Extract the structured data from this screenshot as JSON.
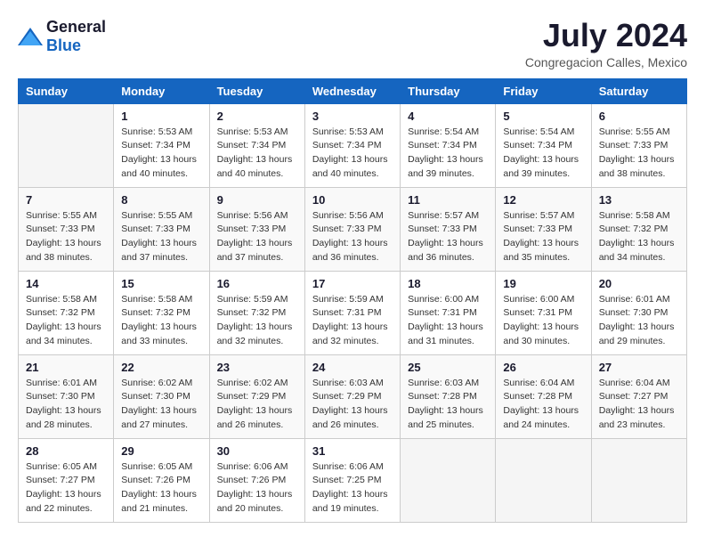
{
  "header": {
    "logo_general": "General",
    "logo_blue": "Blue",
    "month_title": "July 2024",
    "location": "Congregacion Calles, Mexico"
  },
  "weekdays": [
    "Sunday",
    "Monday",
    "Tuesday",
    "Wednesday",
    "Thursday",
    "Friday",
    "Saturday"
  ],
  "weeks": [
    [
      {
        "day": "",
        "info": ""
      },
      {
        "day": "1",
        "info": "Sunrise: 5:53 AM\nSunset: 7:34 PM\nDaylight: 13 hours\nand 40 minutes."
      },
      {
        "day": "2",
        "info": "Sunrise: 5:53 AM\nSunset: 7:34 PM\nDaylight: 13 hours\nand 40 minutes."
      },
      {
        "day": "3",
        "info": "Sunrise: 5:53 AM\nSunset: 7:34 PM\nDaylight: 13 hours\nand 40 minutes."
      },
      {
        "day": "4",
        "info": "Sunrise: 5:54 AM\nSunset: 7:34 PM\nDaylight: 13 hours\nand 39 minutes."
      },
      {
        "day": "5",
        "info": "Sunrise: 5:54 AM\nSunset: 7:34 PM\nDaylight: 13 hours\nand 39 minutes."
      },
      {
        "day": "6",
        "info": "Sunrise: 5:55 AM\nSunset: 7:33 PM\nDaylight: 13 hours\nand 38 minutes."
      }
    ],
    [
      {
        "day": "7",
        "info": "Sunrise: 5:55 AM\nSunset: 7:33 PM\nDaylight: 13 hours\nand 38 minutes."
      },
      {
        "day": "8",
        "info": "Sunrise: 5:55 AM\nSunset: 7:33 PM\nDaylight: 13 hours\nand 37 minutes."
      },
      {
        "day": "9",
        "info": "Sunrise: 5:56 AM\nSunset: 7:33 PM\nDaylight: 13 hours\nand 37 minutes."
      },
      {
        "day": "10",
        "info": "Sunrise: 5:56 AM\nSunset: 7:33 PM\nDaylight: 13 hours\nand 36 minutes."
      },
      {
        "day": "11",
        "info": "Sunrise: 5:57 AM\nSunset: 7:33 PM\nDaylight: 13 hours\nand 36 minutes."
      },
      {
        "day": "12",
        "info": "Sunrise: 5:57 AM\nSunset: 7:33 PM\nDaylight: 13 hours\nand 35 minutes."
      },
      {
        "day": "13",
        "info": "Sunrise: 5:58 AM\nSunset: 7:32 PM\nDaylight: 13 hours\nand 34 minutes."
      }
    ],
    [
      {
        "day": "14",
        "info": "Sunrise: 5:58 AM\nSunset: 7:32 PM\nDaylight: 13 hours\nand 34 minutes."
      },
      {
        "day": "15",
        "info": "Sunrise: 5:58 AM\nSunset: 7:32 PM\nDaylight: 13 hours\nand 33 minutes."
      },
      {
        "day": "16",
        "info": "Sunrise: 5:59 AM\nSunset: 7:32 PM\nDaylight: 13 hours\nand 32 minutes."
      },
      {
        "day": "17",
        "info": "Sunrise: 5:59 AM\nSunset: 7:31 PM\nDaylight: 13 hours\nand 32 minutes."
      },
      {
        "day": "18",
        "info": "Sunrise: 6:00 AM\nSunset: 7:31 PM\nDaylight: 13 hours\nand 31 minutes."
      },
      {
        "day": "19",
        "info": "Sunrise: 6:00 AM\nSunset: 7:31 PM\nDaylight: 13 hours\nand 30 minutes."
      },
      {
        "day": "20",
        "info": "Sunrise: 6:01 AM\nSunset: 7:30 PM\nDaylight: 13 hours\nand 29 minutes."
      }
    ],
    [
      {
        "day": "21",
        "info": "Sunrise: 6:01 AM\nSunset: 7:30 PM\nDaylight: 13 hours\nand 28 minutes."
      },
      {
        "day": "22",
        "info": "Sunrise: 6:02 AM\nSunset: 7:30 PM\nDaylight: 13 hours\nand 27 minutes."
      },
      {
        "day": "23",
        "info": "Sunrise: 6:02 AM\nSunset: 7:29 PM\nDaylight: 13 hours\nand 26 minutes."
      },
      {
        "day": "24",
        "info": "Sunrise: 6:03 AM\nSunset: 7:29 PM\nDaylight: 13 hours\nand 26 minutes."
      },
      {
        "day": "25",
        "info": "Sunrise: 6:03 AM\nSunset: 7:28 PM\nDaylight: 13 hours\nand 25 minutes."
      },
      {
        "day": "26",
        "info": "Sunrise: 6:04 AM\nSunset: 7:28 PM\nDaylight: 13 hours\nand 24 minutes."
      },
      {
        "day": "27",
        "info": "Sunrise: 6:04 AM\nSunset: 7:27 PM\nDaylight: 13 hours\nand 23 minutes."
      }
    ],
    [
      {
        "day": "28",
        "info": "Sunrise: 6:05 AM\nSunset: 7:27 PM\nDaylight: 13 hours\nand 22 minutes."
      },
      {
        "day": "29",
        "info": "Sunrise: 6:05 AM\nSunset: 7:26 PM\nDaylight: 13 hours\nand 21 minutes."
      },
      {
        "day": "30",
        "info": "Sunrise: 6:06 AM\nSunset: 7:26 PM\nDaylight: 13 hours\nand 20 minutes."
      },
      {
        "day": "31",
        "info": "Sunrise: 6:06 AM\nSunset: 7:25 PM\nDaylight: 13 hours\nand 19 minutes."
      },
      {
        "day": "",
        "info": ""
      },
      {
        "day": "",
        "info": ""
      },
      {
        "day": "",
        "info": ""
      }
    ]
  ]
}
